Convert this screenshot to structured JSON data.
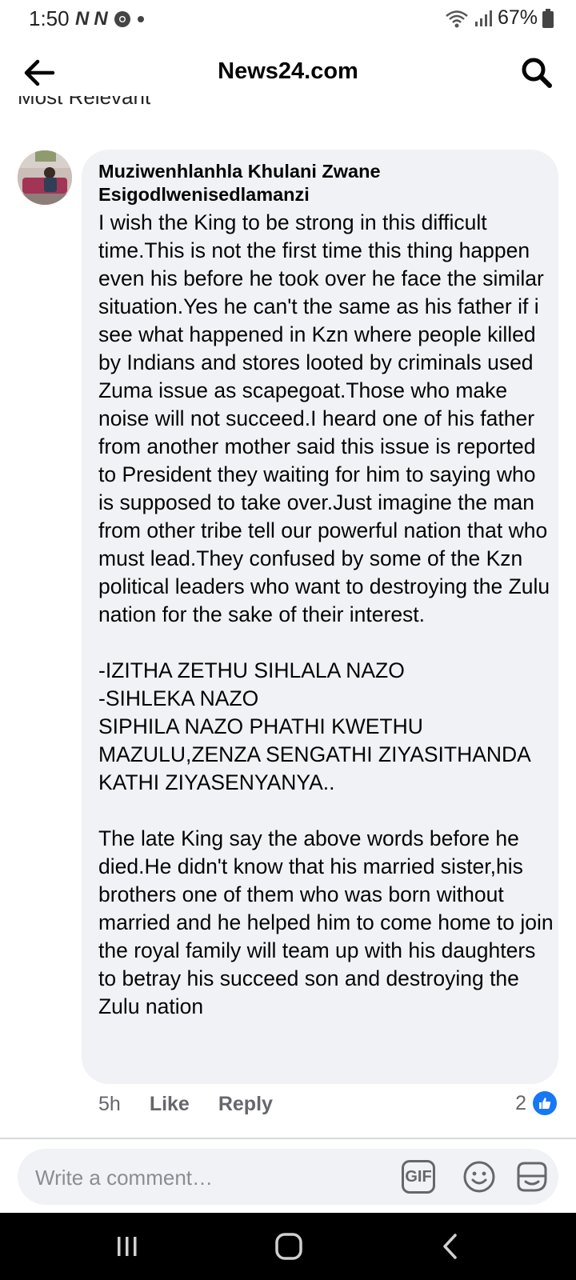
{
  "status_bar": {
    "time": "1:50",
    "notif_icons": [
      "N",
      "N"
    ],
    "battery": "67%"
  },
  "header": {
    "title": "News24.com"
  },
  "partial_text": "Most Relevant",
  "comment": {
    "author_line1": "Muziwenhlanhla Khulani Zwane",
    "author_line2": "Esigodlwenisedlamanzi",
    "text": "I wish the King to be strong in this difficult time.This is not the first time this thing happen even his before he took over he face the similar situation.Yes he can't the same as his father if i see what happened in Kzn where people killed by Indians and stores looted by criminals used Zuma issue as scapegoat.Those who make noise will not succeed.I heard one of his father from another mother said this issue is reported to President they waiting for him to saying who is supposed to take over.Just imagine the man from other tribe tell our powerful nation that who must lead.They confused by some of the Kzn political leaders who want to destroying the Zulu nation for the sake of their interest.\n\n-IZITHA ZETHU SIHLALA NAZO\n-SIHLEKA NAZO\nSIPHILA NAZO PHATHI KWETHU MAZULU,ZENZA SENGATHI ZIYASITHANDA KATHI ZIYASENYANYA..\n\nThe late King say the above words before he died.He didn't know that his married sister,his brothers one of them who was born without married and he helped him to come home to join the royal family will team up with his daughters to betray his succeed son and destroying the Zulu nation",
    "time_ago": "5h",
    "like_label": "Like",
    "reply_label": "Reply",
    "reaction_count": "2"
  },
  "composer": {
    "placeholder": "Write a comment…",
    "gif_label": "GIF"
  },
  "colors": {
    "accent": "#1877f2",
    "bubble": "#f0f2f5",
    "secondary_text": "#65676b"
  }
}
